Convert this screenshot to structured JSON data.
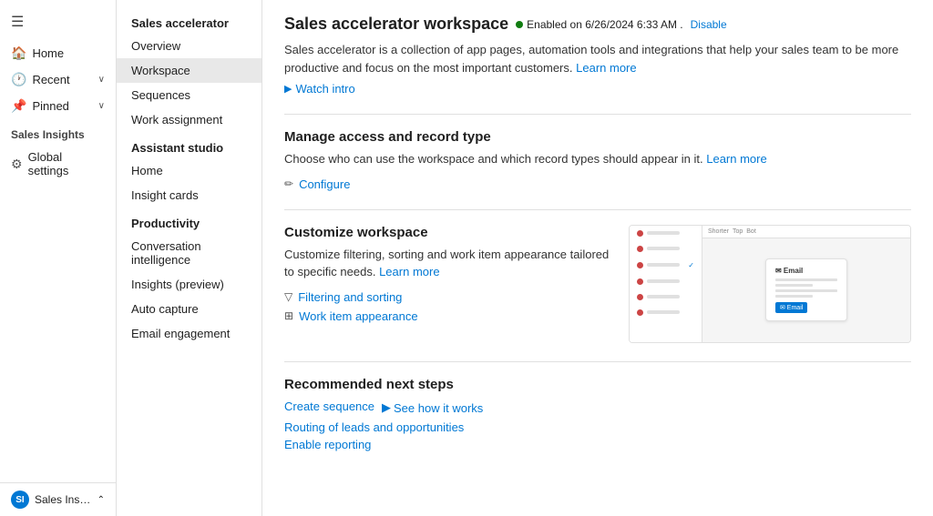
{
  "leftNav": {
    "hamburger": "☰",
    "items": [
      {
        "id": "home",
        "label": "Home",
        "icon": "🏠"
      },
      {
        "id": "recent",
        "label": "Recent",
        "icon": "🕐",
        "hasChevron": true
      },
      {
        "id": "pinned",
        "label": "Pinned",
        "icon": "📌",
        "hasChevron": true
      }
    ],
    "salesInsightsLabel": "Sales Insights",
    "globalSettings": {
      "label": "Global settings",
      "icon": "⚙"
    },
    "bottom": {
      "initials": "SI",
      "label": "Sales Insights sett...",
      "chevron": "⌃"
    }
  },
  "sidebar": {
    "salesAcceleratorLabel": "Sales accelerator",
    "items": [
      {
        "id": "overview",
        "label": "Overview",
        "active": false
      },
      {
        "id": "workspace",
        "label": "Workspace",
        "active": true
      },
      {
        "id": "sequences",
        "label": "Sequences",
        "active": false
      },
      {
        "id": "work-assignment",
        "label": "Work assignment",
        "active": false
      }
    ],
    "assistantStudioLabel": "Assistant studio",
    "assistantItems": [
      {
        "id": "home-as",
        "label": "Home",
        "active": false
      },
      {
        "id": "insight-cards",
        "label": "Insight cards",
        "active": false
      }
    ],
    "productivityLabel": "Productivity",
    "productivityItems": [
      {
        "id": "conv-intelligence",
        "label": "Conversation intelligence",
        "active": false
      },
      {
        "id": "insights-preview",
        "label": "Insights (preview)",
        "active": false
      },
      {
        "id": "auto-capture",
        "label": "Auto capture",
        "active": false
      },
      {
        "id": "email-engagement",
        "label": "Email engagement",
        "active": false
      }
    ]
  },
  "main": {
    "pageTitle": "Sales accelerator workspace",
    "statusText": "Enabled on 6/26/2024 6:33 AM .",
    "disableLabel": "Disable",
    "description": "Sales accelerator is a collection of app pages, automation tools and integrations that help your sales team to be more productive and focus on the most important customers.",
    "descriptionLearnMore": "Learn more",
    "watchIntro": "Watch intro",
    "manageAccess": {
      "title": "Manage access and record type",
      "description": "Choose who can use the workspace and which record types should appear in it.",
      "learnMore": "Learn more",
      "configureLabel": "Configure",
      "configureIcon": "✏"
    },
    "customizeWorkspace": {
      "title": "Customize workspace",
      "description": "Customize filtering, sorting and work item appearance tailored to specific needs.",
      "learnMore": "Learn more",
      "filteringLabel": "Filtering and sorting",
      "filteringIcon": "▽",
      "workItemLabel": "Work item appearance",
      "workItemIcon": "☰",
      "previewDots": [
        {
          "color": "#c44"
        },
        {
          "color": "#c44"
        },
        {
          "color": "#c44"
        },
        {
          "color": "#c44"
        },
        {
          "color": "#c44"
        },
        {
          "color": "#c44"
        }
      ],
      "previewHeaderItems": [
        "Shorter",
        "Top",
        "Bot"
      ]
    },
    "recommendedSteps": {
      "title": "Recommended next steps",
      "steps": [
        {
          "id": "create-sequence",
          "label": "Create sequence"
        },
        {
          "id": "routing",
          "label": "Routing of leads and opportunities"
        },
        {
          "id": "enable-reporting",
          "label": "Enable reporting"
        }
      ],
      "seeHowLabel": "See how it works",
      "playIcon": "▶"
    }
  }
}
